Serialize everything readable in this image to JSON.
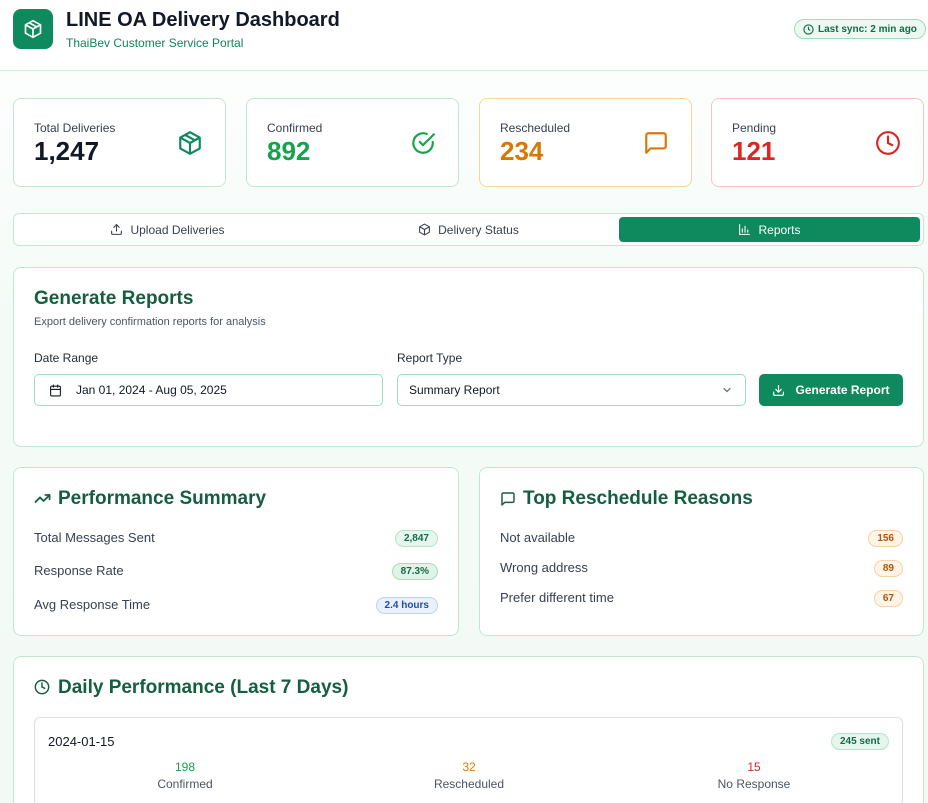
{
  "header": {
    "title": "LINE OA Delivery Dashboard",
    "subtitle": "ThaiBev Customer Service Portal",
    "sync": "Last sync: 2 min ago"
  },
  "stats": [
    {
      "label": "Total Deliveries",
      "value": "1,247",
      "color": "#111827",
      "icon": "package-icon"
    },
    {
      "label": "Confirmed",
      "value": "892",
      "color": "#16a34a",
      "icon": "check-circle-icon"
    },
    {
      "label": "Rescheduled",
      "value": "234",
      "color": "#d97706",
      "icon": "message-icon"
    },
    {
      "label": "Pending",
      "value": "121",
      "color": "#dc2626",
      "icon": "clock-icon"
    }
  ],
  "tabs": [
    {
      "label": "Upload Deliveries",
      "icon": "upload-icon",
      "active": false
    },
    {
      "label": "Delivery Status",
      "icon": "package-icon",
      "active": false
    },
    {
      "label": "Reports",
      "icon": "bar-chart-icon",
      "active": true
    }
  ],
  "report": {
    "title": "Generate Reports",
    "subtitle": "Export delivery confirmation reports for analysis",
    "date_label": "Date Range",
    "date_value": "Jan 01, 2024 - Aug 05, 2025",
    "type_label": "Report Type",
    "type_value": "Summary Report",
    "button": "Generate Report"
  },
  "performance": {
    "title": "Performance Summary",
    "rows": [
      {
        "label": "Total Messages Sent",
        "value": "2,847"
      },
      {
        "label": "Response Rate",
        "value": "87.3%"
      },
      {
        "label": "Avg Response Time",
        "value": "2.4 hours"
      }
    ]
  },
  "reasons": {
    "title": "Top Reschedule Reasons",
    "rows": [
      {
        "label": "Not available",
        "value": "156"
      },
      {
        "label": "Wrong address",
        "value": "89"
      },
      {
        "label": "Prefer different time",
        "value": "67"
      }
    ]
  },
  "daily": {
    "title": "Daily Performance (Last 7 Days)",
    "days": [
      {
        "date": "2024-01-15",
        "sent": "245 sent",
        "confirmed": "198",
        "confirmed_label": "Confirmed",
        "rescheduled": "32",
        "rescheduled_label": "Rescheduled",
        "no_response": "15",
        "no_response_label": "No Response"
      }
    ]
  },
  "colors": {
    "brand": "#0f8a5f",
    "confirmed": "#16a34a",
    "rescheduled": "#d97706",
    "pending": "#dc2626"
  }
}
